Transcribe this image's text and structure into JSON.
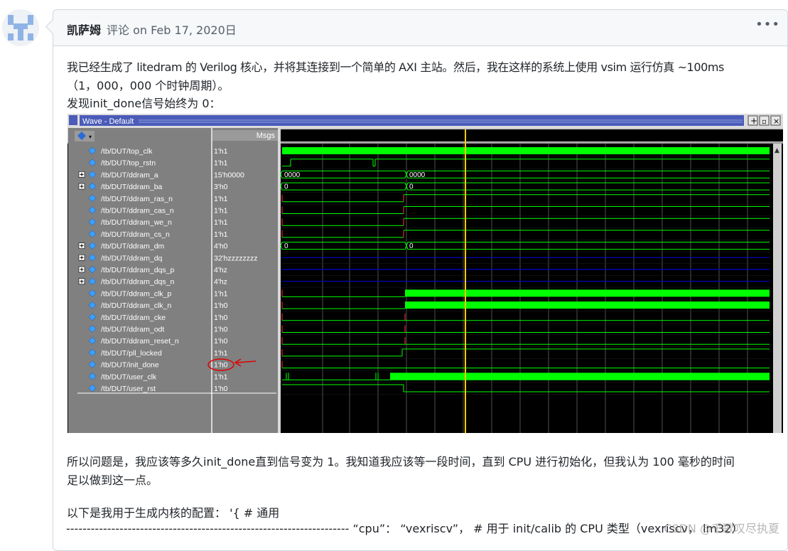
{
  "comment": {
    "author": "凯萨姆",
    "meta": "评论 on Feb 17, 2020日",
    "menu_icon": "kebab-icon",
    "para1_line1": "我已经生成了 litedram 的 Verilog 核心，并将其连接到一个简单的 AXI 主站。然后，我在这样的系统上使用 vsim 运行仿真 ~100ms",
    "para1_line2": "（1，000，000 个时钟周期）。",
    "para1_line3": "发现init_done信号始终为 0：",
    "para2_line1": "所以问题是，我应该等多久init_done直到信号变为 1。我知道我应该等一段时间，直到 CPU 进行初始化，但我认为 100 毫秒的时间",
    "para2_line2": "足以做到这一点。",
    "para3": "以下是我用于生成内核的配置： '{ # 通用",
    "code_line": "--------------------------------------------------------------------- “cpu”： “vexriscv”， # 用于 init/calib 的 CPU 类型（vexriscv， lm32）"
  },
  "watermark": "CSDN @千歌叹尽执夏",
  "wave_window": {
    "title": "Wave - Default",
    "msgs_header": "Msgs",
    "signals": [
      {
        "name": "/tb/DUT/top_clk",
        "value": "1'h1",
        "expand": false
      },
      {
        "name": "/tb/DUT/top_rstn",
        "value": "1'h1",
        "expand": false
      },
      {
        "name": "/tb/DUT/ddram_a",
        "value": "15'h0000",
        "expand": true
      },
      {
        "name": "/tb/DUT/ddram_ba",
        "value": "3'h0",
        "expand": true
      },
      {
        "name": "/tb/DUT/ddram_ras_n",
        "value": "1'h1",
        "expand": false
      },
      {
        "name": "/tb/DUT/ddram_cas_n",
        "value": "1'h1",
        "expand": false
      },
      {
        "name": "/tb/DUT/ddram_we_n",
        "value": "1'h1",
        "expand": false
      },
      {
        "name": "/tb/DUT/ddram_cs_n",
        "value": "1'h1",
        "expand": false
      },
      {
        "name": "/tb/DUT/ddram_dm",
        "value": "4'h0",
        "expand": true
      },
      {
        "name": "/tb/DUT/ddram_dq",
        "value": "32'hzzzzzzzz",
        "expand": true
      },
      {
        "name": "/tb/DUT/ddram_dqs_p",
        "value": "4'hz",
        "expand": true
      },
      {
        "name": "/tb/DUT/ddram_dqs_n",
        "value": "4'hz",
        "expand": true
      },
      {
        "name": "/tb/DUT/ddram_clk_p",
        "value": "1'h1",
        "expand": false
      },
      {
        "name": "/tb/DUT/ddram_clk_n",
        "value": "1'h0",
        "expand": false
      },
      {
        "name": "/tb/DUT/ddram_cke",
        "value": "1'h0",
        "expand": false
      },
      {
        "name": "/tb/DUT/ddram_odt",
        "value": "1'h0",
        "expand": false
      },
      {
        "name": "/tb/DUT/ddram_reset_n",
        "value": "1'h0",
        "expand": false
      },
      {
        "name": "/tb/DUT/pll_locked",
        "value": "1'h1",
        "expand": false
      },
      {
        "name": "/tb/DUT/init_done",
        "value": "1'h0",
        "expand": false
      },
      {
        "name": "/tb/DUT/user_clk",
        "value": "1'h1",
        "expand": false
      },
      {
        "name": "/tb/DUT/user_rst",
        "value": "1'h0",
        "expand": false
      }
    ],
    "bus_values": {
      "ddram_a_1": "0000",
      "ddram_a_2": "0000",
      "ddram_ba_1": "0",
      "ddram_ba_2": "0",
      "ddram_dm_1": "0",
      "ddram_dm_2": "0"
    },
    "colors": {
      "signal": "#00ff00",
      "bus_z": "#0000cc",
      "cursor": "#ffcc00",
      "panel": "#808080",
      "title_bar": "#4a5bb8",
      "annotation": "#e00000"
    }
  }
}
